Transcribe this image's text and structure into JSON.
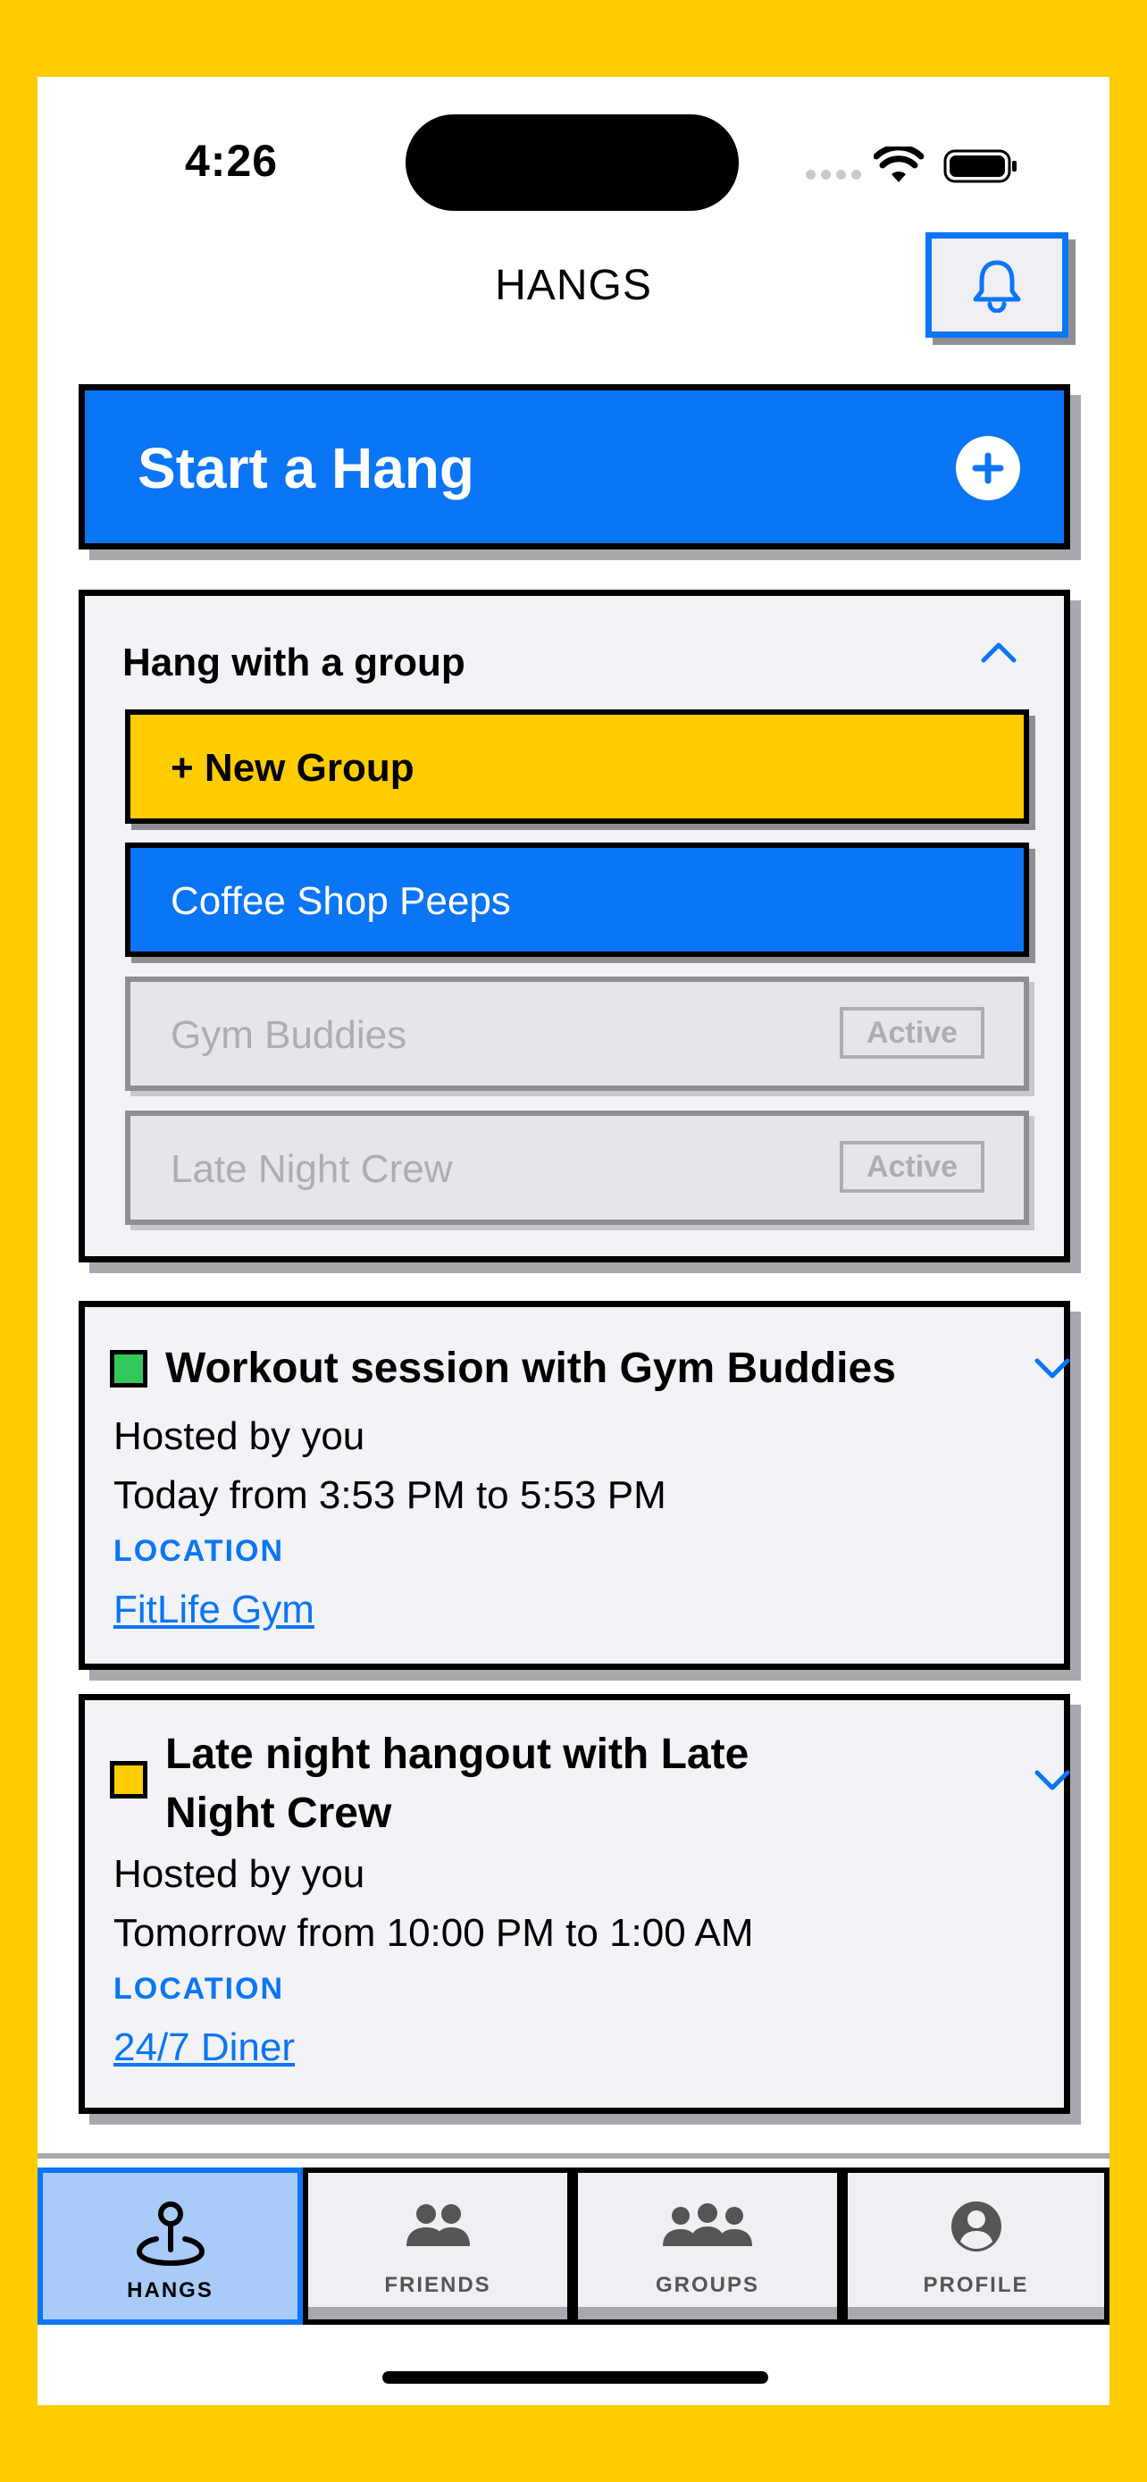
{
  "status_bar": {
    "time": "4:26"
  },
  "header": {
    "title": "HANGS"
  },
  "start_hang": {
    "label": "Start a Hang"
  },
  "group_section": {
    "title": "Hang with a group",
    "new_group_label": "+ New Group",
    "groups": [
      {
        "name": "Coffee Shop Peeps",
        "state": "selected"
      },
      {
        "name": "Gym Buddies",
        "badge": "Active",
        "state": "disabled"
      },
      {
        "name": "Late Night Crew",
        "badge": "Active",
        "state": "disabled"
      }
    ]
  },
  "hangs": [
    {
      "title": "Workout session with Gym Buddies",
      "color": "#34C759",
      "host": "Hosted by you",
      "time": "Today from 3:53 PM to 5:53 PM",
      "location_label": "LOCATION",
      "location": "FitLife Gym"
    },
    {
      "title_line1": "Late night hangout with Late",
      "title_line2": "Night Crew",
      "color": "#FFCC00",
      "host": "Hosted by you",
      "time": "Tomorrow from 10:00 PM to 1:00 AM",
      "location_label": "LOCATION",
      "location": "24/7 Diner"
    }
  ],
  "tabs": [
    {
      "label": "HANGS",
      "icon": "map-pin-icon",
      "active": true
    },
    {
      "label": "FRIENDS",
      "icon": "friends-icon",
      "active": false
    },
    {
      "label": "GROUPS",
      "icon": "groups-icon",
      "active": false
    },
    {
      "label": "PROFILE",
      "icon": "profile-icon",
      "active": false
    }
  ],
  "colors": {
    "accent": "#0A75F5",
    "background": "#FFCC00",
    "card": "#F2F2F7"
  }
}
